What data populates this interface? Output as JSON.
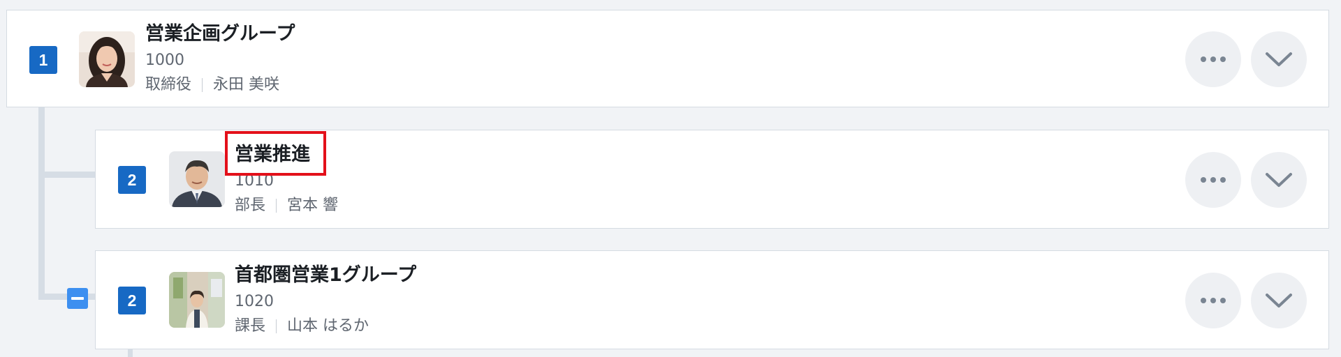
{
  "rows": [
    {
      "level": "1",
      "name": "営業企画グループ",
      "code": "1000",
      "title": "取締役",
      "person": "永田 美咲",
      "avatar_icon": "person-photo-woman"
    },
    {
      "level": "2",
      "name": "営業推進",
      "code": "1010",
      "title": "部長",
      "person": "宮本 響",
      "avatar_icon": "person-photo-man-suit"
    },
    {
      "level": "2",
      "name": "首都圏営業1グループ",
      "code": "1020",
      "title": "課長",
      "person": "山本 はるか",
      "avatar_icon": "person-photo-office"
    }
  ],
  "icons": {
    "more": "more-horizontal-icon",
    "expand": "chevron-down-icon",
    "collapse": "collapse-minus-icon"
  },
  "colors": {
    "badge": "#1769c4",
    "highlight": "#e3101a",
    "toggle": "#3d8ff0",
    "tree_line": "#d6dde5"
  }
}
